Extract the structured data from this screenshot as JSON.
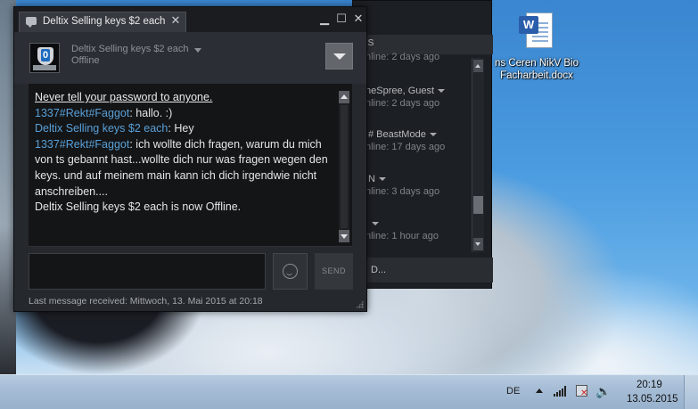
{
  "chat": {
    "tab_label": "Deltix Selling keys $2 each",
    "friend_name": "Deltix Selling keys $2 each",
    "friend_status": "Offline",
    "send_label": "SEND",
    "last_message": "Last message received: Mittwoch, 13. Mai 2015 at 20:18",
    "messages": {
      "warning": "Never tell your password to anyone.",
      "m1_sender": "1337#Rekt#Faggot",
      "m1_text": ": hallo. :)",
      "m2_sender": "Deltix Selling keys $2 each",
      "m2_text": ": Hey",
      "m3_sender": "1337#Rekt#Faggot",
      "m3_text": ": ich wollte dich fragen, warum du mich von ts gebannt hast...wollte dich nur was fragen wegen den keys. und auf meinem main kann ich dich irgendwie nicht anschreiben....",
      "system": "Deltix Selling keys $2 each is now Offline."
    }
  },
  "friends": {
    "tab_label": "PS",
    "rows": [
      {
        "name": "",
        "status": "nline: 2 days ago"
      },
      {
        "name": "neSpree, Guest",
        "status": "nline: 2 days ago"
      },
      {
        "name": "# BeastMode",
        "status": "nline: 17 days ago"
      },
      {
        "name": "N",
        "status": "nline: 3 days ago"
      },
      {
        "name": "",
        "status": "nline: 1 hour ago"
      }
    ],
    "bottom_label": "D..."
  },
  "desktop": {
    "icon_label_line1": "ns Ceren NikV Bio",
    "icon_label_line2": "Facharbeit.docx",
    "icon_badge": "W"
  },
  "taskbar": {
    "language": "DE",
    "time": "20:19",
    "date": "13.05.2015"
  }
}
